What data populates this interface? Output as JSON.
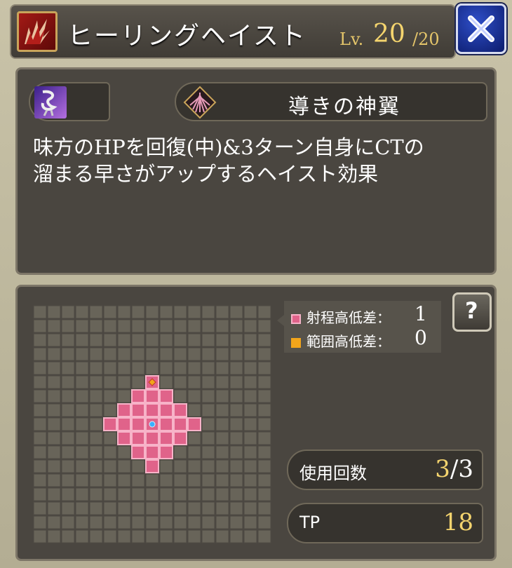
{
  "skill": {
    "name": "ヒーリングヘイスト",
    "level_label": "Lv.",
    "level": "20",
    "level_max": "/20"
  },
  "icons": {
    "skill": "red-slash-skill-icon",
    "close": "close-x-icon",
    "element": "purple-dark-element-icon",
    "charm": "wing-crest-icon",
    "help": "help-question-icon"
  },
  "charm": {
    "name": "導きの神翼"
  },
  "description": {
    "line1": "味方のHPを回復(中)&3ターン自身にCTの",
    "line2": "溜まる早さがアップするヘイスト効果"
  },
  "legend": {
    "range_height_label": "射程高低差：",
    "range_height_value": "1",
    "area_height_label": "範囲高低差：",
    "area_height_value": "0"
  },
  "stats": {
    "uses_label": "使用回数",
    "uses_current": "3",
    "uses_total": "/3",
    "tp_label": "TP",
    "tp_value": "18"
  },
  "colors": {
    "range_cell": "#e0638a",
    "area_marker": "#f2a51b",
    "gold_text": "#f4d46e",
    "close_blue": "#1c38a8"
  },
  "range_map": {
    "cols": 17,
    "rows": 17,
    "caster": [
      8,
      8
    ],
    "target": [
      8,
      5
    ],
    "range_cells": [
      [
        8,
        5
      ],
      [
        7,
        6
      ],
      [
        8,
        6
      ],
      [
        9,
        6
      ],
      [
        6,
        7
      ],
      [
        7,
        7
      ],
      [
        8,
        7
      ],
      [
        9,
        7
      ],
      [
        10,
        7
      ],
      [
        5,
        8
      ],
      [
        6,
        8
      ],
      [
        7,
        8
      ],
      [
        8,
        8
      ],
      [
        9,
        8
      ],
      [
        10,
        8
      ],
      [
        11,
        8
      ],
      [
        6,
        9
      ],
      [
        7,
        9
      ],
      [
        8,
        9
      ],
      [
        9,
        9
      ],
      [
        10,
        9
      ],
      [
        7,
        10
      ],
      [
        8,
        10
      ],
      [
        9,
        10
      ],
      [
        8,
        11
      ]
    ]
  }
}
